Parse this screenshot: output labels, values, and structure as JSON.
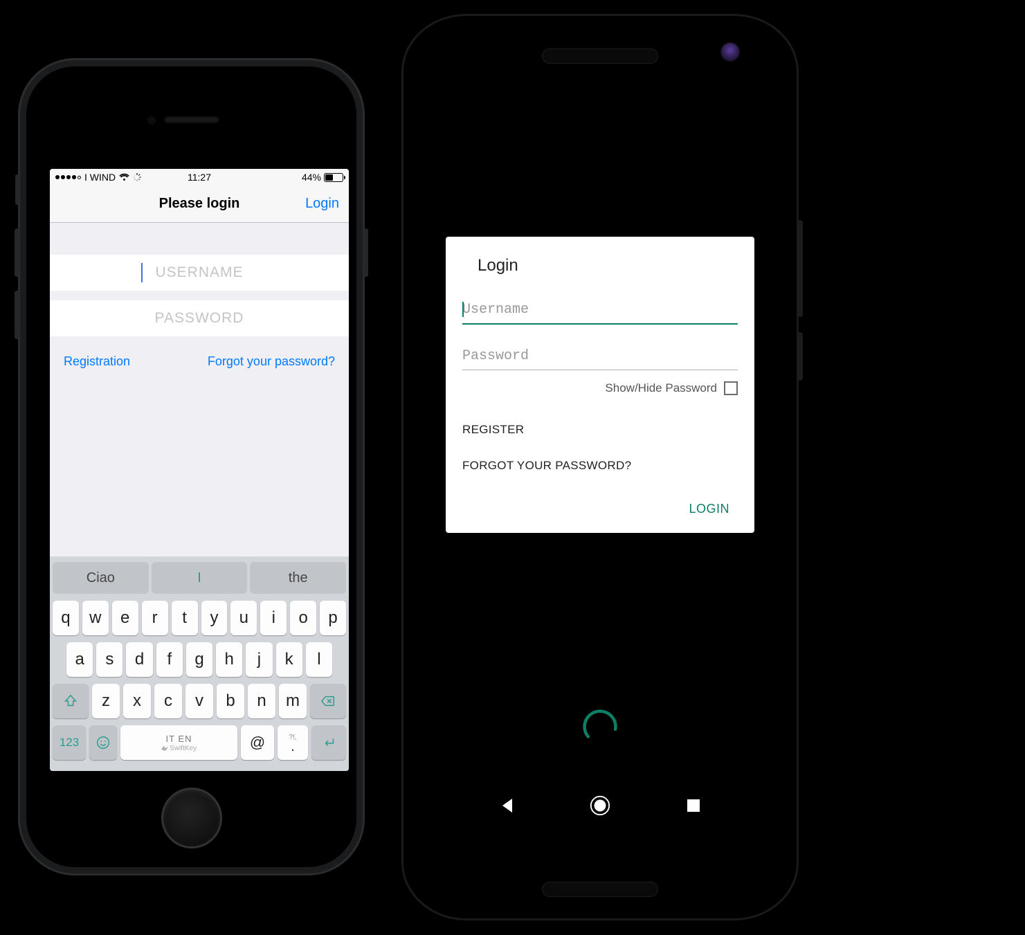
{
  "ios": {
    "status": {
      "carrier": "I WIND",
      "time": "11:27",
      "battery_pct": "44%"
    },
    "nav": {
      "title": "Please login",
      "action": "Login"
    },
    "inputs": {
      "username_placeholder": "USERNAME",
      "password_placeholder": "PASSWORD"
    },
    "links": {
      "registration": "Registration",
      "forgot": "Forgot your password?"
    },
    "keyboard": {
      "suggest": [
        "Ciao",
        "I",
        "the"
      ],
      "row1": [
        "q",
        "w",
        "e",
        "r",
        "t",
        "y",
        "u",
        "i",
        "o",
        "p"
      ],
      "row2": [
        "a",
        "s",
        "d",
        "f",
        "g",
        "h",
        "j",
        "k",
        "l"
      ],
      "row3": [
        "z",
        "x",
        "c",
        "v",
        "b",
        "n",
        "m"
      ],
      "numkey": "123",
      "space_lang": "IT EN",
      "space_brand": "SwiftKey",
      "at": "@",
      "punct_top": "?!,",
      "punct_bot": "."
    }
  },
  "android": {
    "dialog": {
      "title": "Login",
      "username_placeholder": "Username",
      "password_placeholder": "Password",
      "show_hide": "Show/Hide Password",
      "register": "REGISTER",
      "forgot": "FORGOT YOUR PASSWORD?",
      "login": "LOGIN"
    }
  },
  "colors": {
    "ios_accent": "#007aff",
    "android_accent": "#0c7f66"
  }
}
